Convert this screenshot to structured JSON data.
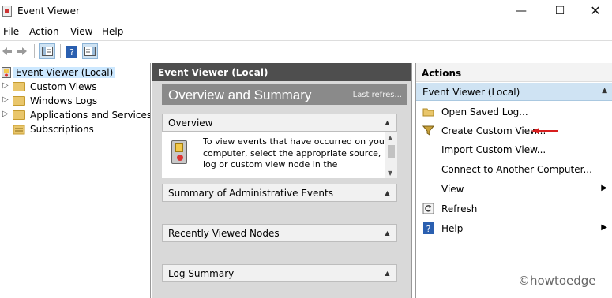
{
  "window": {
    "title": "Event Viewer",
    "controls": {
      "minimize": "—",
      "maximize": "☐",
      "close": "✕"
    }
  },
  "menu": [
    "File",
    "Action",
    "View",
    "Help"
  ],
  "toolbar": {
    "icons": [
      "back-arrow-icon",
      "forward-arrow-icon",
      "show-hide-tree-icon",
      "help-icon",
      "properties-icon"
    ]
  },
  "tree": {
    "items": [
      {
        "label": "Event Viewer (Local)",
        "selected": true
      },
      {
        "label": "Custom Views"
      },
      {
        "label": "Windows Logs"
      },
      {
        "label": "Applications and Services Lo"
      },
      {
        "label": "Subscriptions"
      }
    ]
  },
  "center": {
    "header": "Event Viewer (Local)",
    "banner_title": "Overview and Summary",
    "banner_right": "Last refres...",
    "sections": [
      {
        "title": "Overview"
      },
      {
        "title": "Summary of Administrative Events"
      },
      {
        "title": "Recently Viewed Nodes"
      },
      {
        "title": "Log Summary"
      }
    ],
    "overview_text": "To view events that have occurred on your computer, select the appropriate source, log or custom view node in the"
  },
  "actions": {
    "header": "Actions",
    "group": "Event Viewer (Local)",
    "items": [
      {
        "label": "Open Saved Log...",
        "icon": "open-folder-icon"
      },
      {
        "label": "Create Custom View...",
        "icon": "filter-icon"
      },
      {
        "label": "Import Custom View...",
        "icon": ""
      },
      {
        "label": "Connect to Another Computer...",
        "icon": ""
      },
      {
        "label": "View",
        "icon": "",
        "submenu": "▶"
      },
      {
        "label": "Refresh",
        "icon": "refresh-icon"
      },
      {
        "label": "Help",
        "icon": "help-icon",
        "submenu": "▶"
      }
    ]
  },
  "watermark": "©howtoedge",
  "colors": {
    "pane_header": "#4e4e4e",
    "banner": "#8a8a8a",
    "action_group": "#cfe3f3",
    "selection": "#cce8ff",
    "annotation_arrow": "#d81e1e"
  }
}
